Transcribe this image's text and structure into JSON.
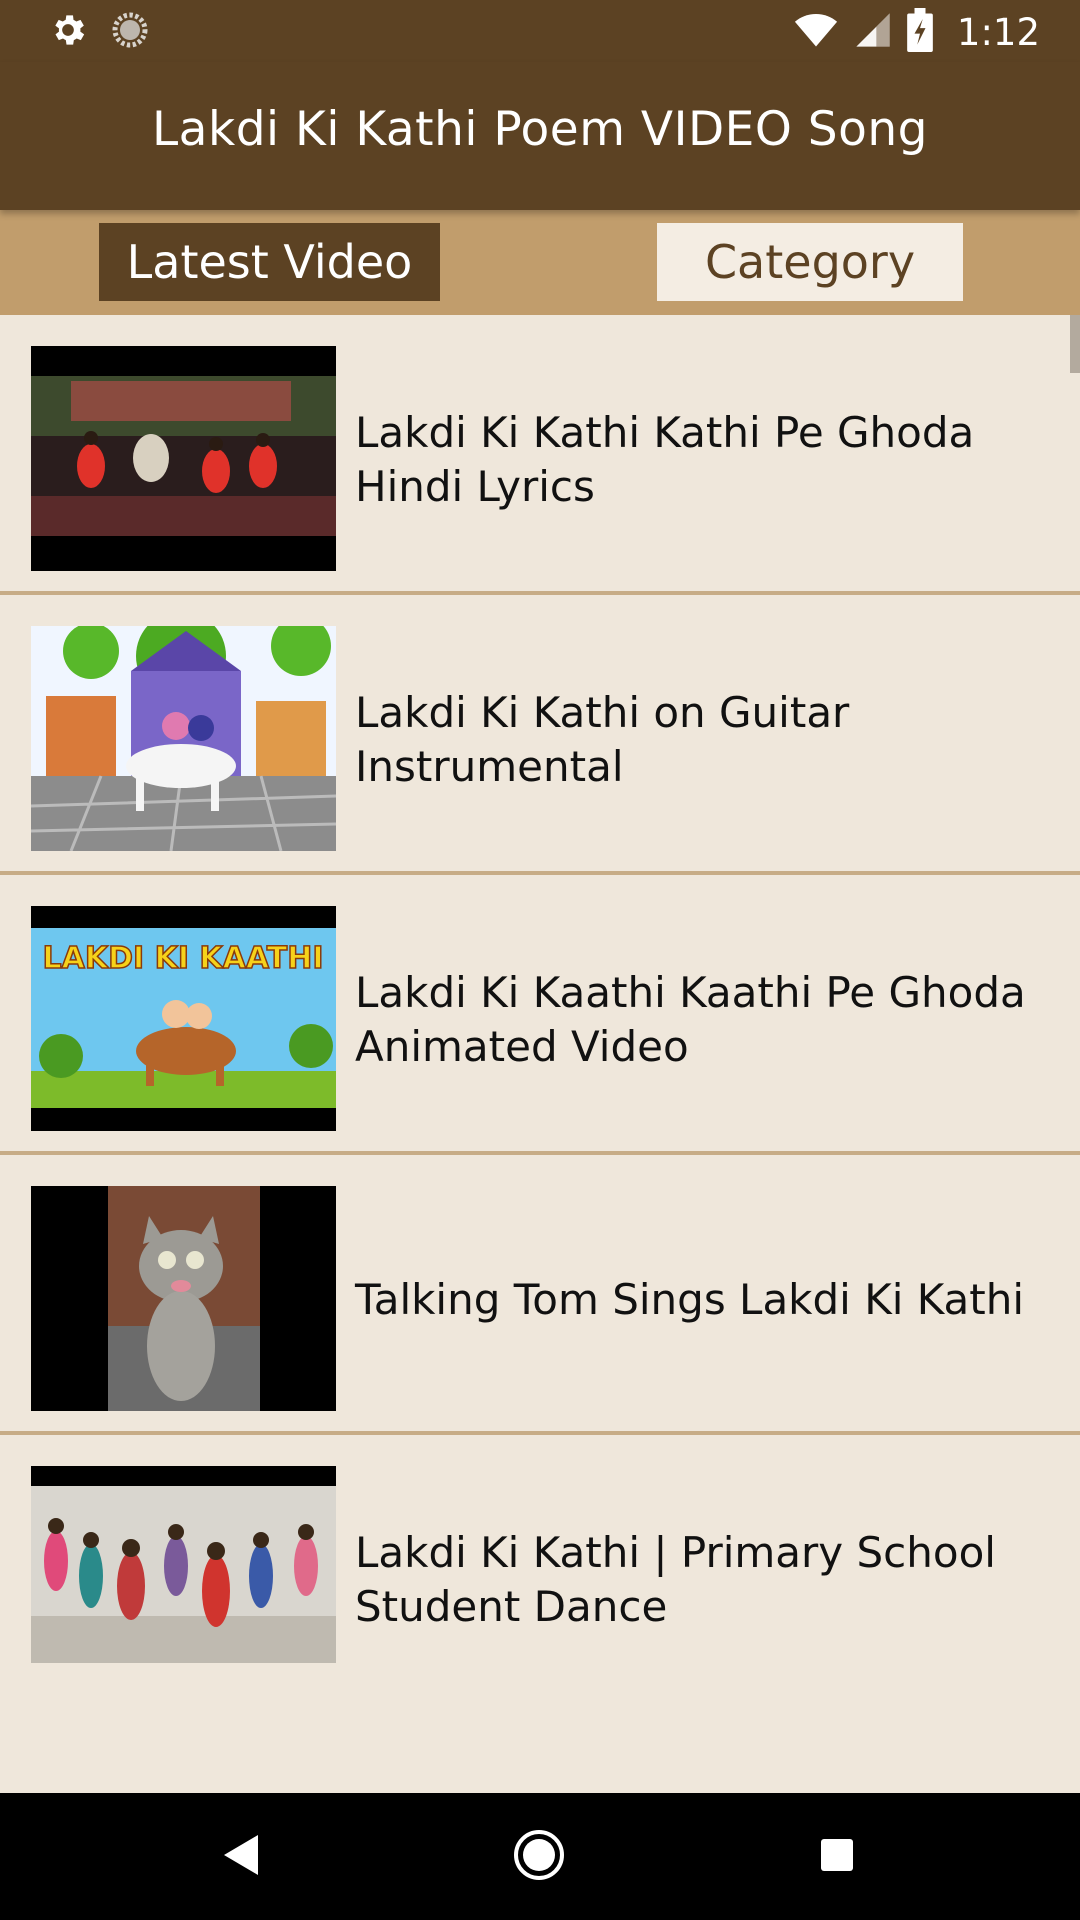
{
  "status_bar": {
    "time": "1:12",
    "icons": [
      "settings-icon",
      "sync-icon",
      "wifi-icon",
      "signal-icon",
      "battery-icon"
    ]
  },
  "app_bar": {
    "title": "Lakdi Ki Kathi Poem VIDEO Song"
  },
  "tabs": [
    {
      "label": "Latest Video",
      "selected": true
    },
    {
      "label": "Category",
      "selected": false
    }
  ],
  "videos": [
    {
      "title": "Lakdi Ki Kathi Kathi Pe Ghoda Hindi Lyrics"
    },
    {
      "title": "Lakdi Ki Kathi on Guitar Instrumental"
    },
    {
      "title": "Lakdi Ki Kaathi Kaathi Pe Ghoda Animated Video",
      "thumbnail_text": "LAKDI KI KAATHI"
    },
    {
      "title": "Talking Tom Sings Lakdi Ki Kathi"
    },
    {
      "title": "Lakdi Ki Kathi | Primary School Student Dance"
    }
  ],
  "nav_bar": {
    "icons": [
      "back-icon",
      "home-icon",
      "recents-icon"
    ]
  },
  "colors": {
    "primary": "#5c4223",
    "tab_background": "#c19d6c",
    "list_background": "#efe7db",
    "divider": "#c7ac86"
  }
}
